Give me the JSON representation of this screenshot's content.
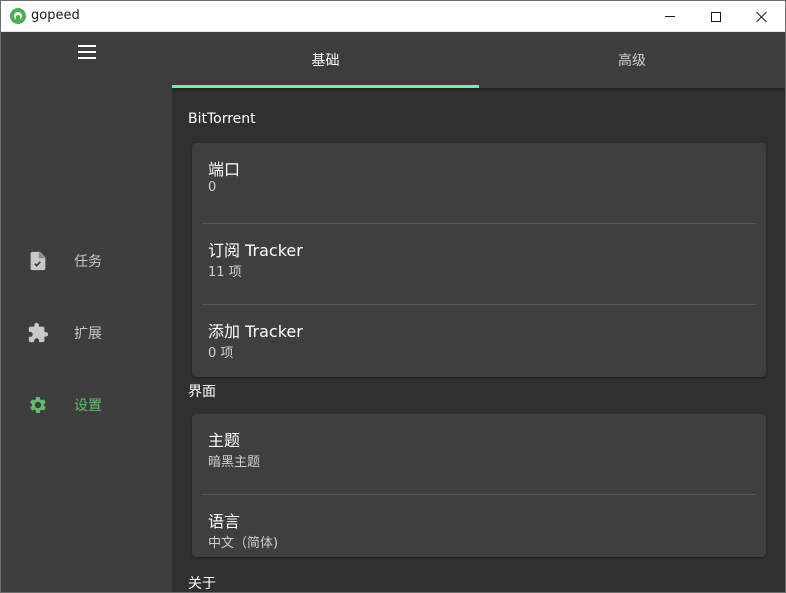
{
  "window": {
    "app_name": "gopeed"
  },
  "sidebar": {
    "items": [
      {
        "label": "任务",
        "icon": "file-task-icon"
      },
      {
        "label": "扩展",
        "icon": "puzzle-icon"
      },
      {
        "label": "设置",
        "icon": "gear-icon",
        "active": true
      }
    ],
    "active_color": "#66bb6a"
  },
  "tabs": [
    {
      "label": "基础",
      "active": true
    },
    {
      "label": "高级",
      "active": false
    }
  ],
  "tab_indicator_color": "#69f0ae",
  "sections": [
    {
      "title": "BitTorrent",
      "rows": [
        {
          "title": "端口",
          "value": "0"
        },
        {
          "title": "订阅 Tracker",
          "value": "11 项"
        },
        {
          "title": "添加 Tracker",
          "value": "0 项"
        }
      ]
    },
    {
      "title": "界面",
      "rows": [
        {
          "title": "主题",
          "value": "暗黑主题"
        },
        {
          "title": "语言",
          "value": "中文（简体)"
        }
      ]
    },
    {
      "title": "关于"
    }
  ]
}
